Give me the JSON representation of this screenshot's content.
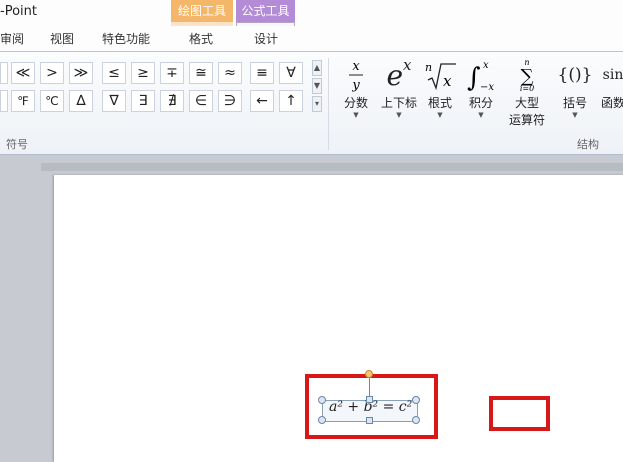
{
  "window": {
    "title": "-Point"
  },
  "context_tabs": {
    "drawing_tools": {
      "header": "绘图工具",
      "tab": "格式"
    },
    "equation_tools": {
      "header": "公式工具",
      "tab": "设计"
    }
  },
  "tabs": [
    "审阅",
    "视图",
    "特色功能"
  ],
  "symbols": {
    "row1": [
      "≪",
      ">",
      "≫",
      "≤",
      "≥",
      "∓",
      "≅",
      "≈",
      "≡",
      "∀"
    ],
    "row2": [
      "℉",
      "℃",
      "∆",
      "∇",
      "∃",
      "∄",
      "∈",
      "∋",
      "←",
      "↑"
    ],
    "group_label": "符号"
  },
  "structures": {
    "group_label": "结构",
    "items": [
      {
        "label": "分数",
        "icon": "fraction-icon"
      },
      {
        "label": "上下标",
        "icon": "script-icon",
        "glyph": "e",
        "sup": "x"
      },
      {
        "label": "根式",
        "icon": "radical-icon"
      },
      {
        "label": "积分",
        "icon": "integral-icon"
      },
      {
        "label": "大型",
        "label2": "运算符",
        "icon": "large-operator-icon"
      },
      {
        "label": "括号",
        "icon": "bracket-icon",
        "glyph": "{()}"
      },
      {
        "label": "函数",
        "icon": "function-icon",
        "glyph": "sin"
      }
    ]
  },
  "equation": {
    "text": "a² + b² = c²"
  },
  "colors": {
    "highlight": "#d81818",
    "drawing_tools": "#f4b76a",
    "equation_tools": "#b48bd6"
  }
}
